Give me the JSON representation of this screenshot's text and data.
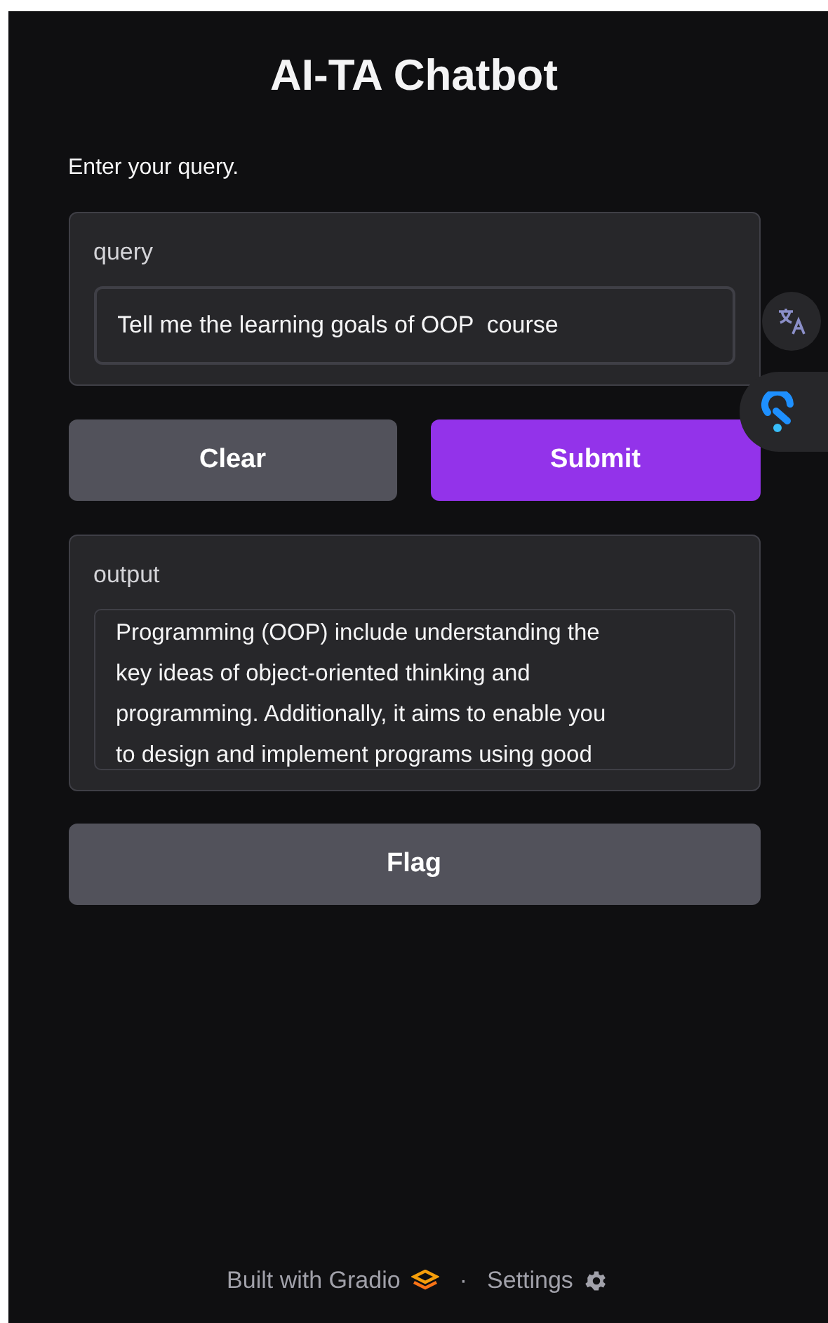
{
  "title": "AI-TA Chatbot",
  "description": "Enter your query.",
  "query": {
    "label": "query",
    "value": "Tell me the learning goals of OOP  course"
  },
  "buttons": [
    {
      "label": "Clear",
      "kind": "secondary"
    },
    {
      "label": "Submit",
      "kind": "primary"
    }
  ],
  "output": {
    "label": "output",
    "lines": [
      "Programming (OOP) include understanding the",
      "key ideas of object-oriented thinking and",
      "programming. Additionally, it aims to enable you",
      "to design and implement programs using good"
    ]
  },
  "flag_button": {
    "label": "Flag"
  },
  "footer": {
    "built_with": "Built with Gradio",
    "separator": "·",
    "settings": "Settings"
  }
}
